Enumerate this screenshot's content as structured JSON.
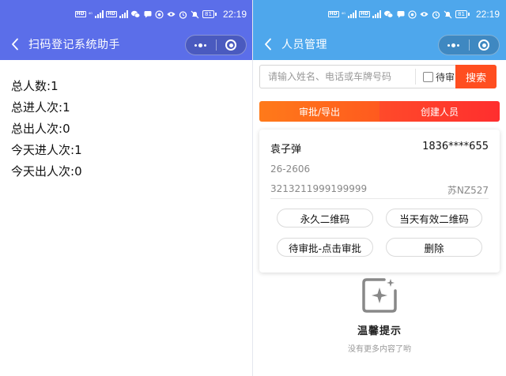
{
  "status_bar": {
    "time": "22:19",
    "battery": "81",
    "net": "HD"
  },
  "left": {
    "nav_title": "扫码登记系统助手",
    "stats": [
      {
        "label": "总人数:",
        "value": "1"
      },
      {
        "label": "总进人次:",
        "value": "1"
      },
      {
        "label": "总出人次:",
        "value": "0"
      },
      {
        "label": "今天进人次:",
        "value": "1"
      },
      {
        "label": "今天出人次:",
        "value": "0"
      }
    ]
  },
  "right": {
    "nav_title": "人员管理",
    "search": {
      "placeholder": "请输入姓名、电话或车牌号码",
      "value": "",
      "pending_label": "待审",
      "pending_checked": false,
      "button": "搜索"
    },
    "tabs": {
      "approve_export": "审批/导出",
      "create_person": "创建人员"
    },
    "person": {
      "name": "袁子弹",
      "phone": "1836****655",
      "room": "26-2606",
      "id_number": "3213211999199999",
      "plate": "苏NZ527"
    },
    "actions": {
      "permanent_qr": "永久二维码",
      "today_qr": "当天有效二维码",
      "pending": "待审批-点击审批",
      "delete": "删除"
    },
    "empty": {
      "title": "温馨提示",
      "subtitle": "没有更多内容了哟"
    }
  },
  "colors": {
    "left_header": "#5B6EE9",
    "right_header": "#4EA7EC",
    "search_button": "#FF4E20",
    "tab_left": "#FF7A1A",
    "tab_right": "#FF2E2E"
  }
}
